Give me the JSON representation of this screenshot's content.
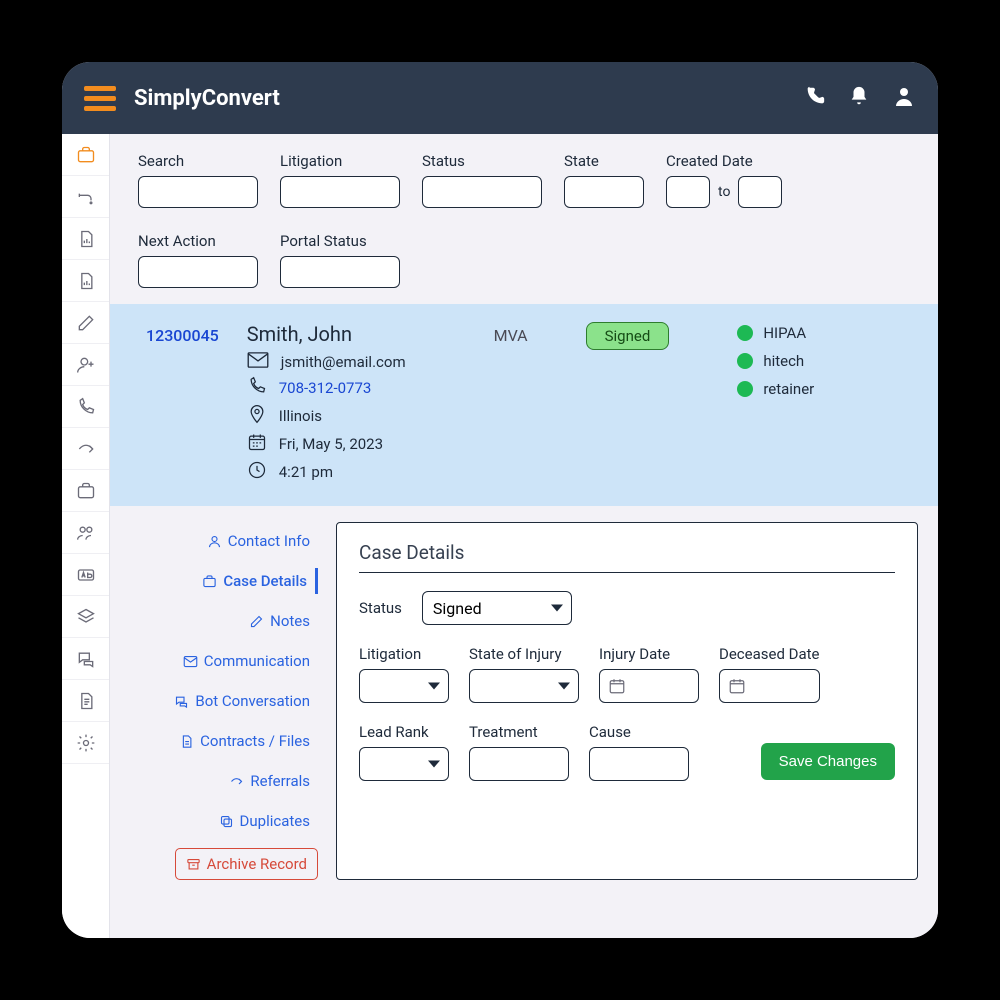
{
  "header": {
    "app_name": "SimplyConvert"
  },
  "filters": {
    "search_label": "Search",
    "litigation_label": "Litigation",
    "status_label": "Status",
    "state_label": "State",
    "created_label": "Created Date",
    "created_to": "to",
    "next_action_label": "Next Action",
    "portal_status_label": "Portal Status"
  },
  "case": {
    "id": "12300045",
    "name": "Smith, John",
    "email": "jsmith@email.com",
    "phone": "708-312-0773",
    "state": "Illinois",
    "date": "Fri, May 5, 2023",
    "time": "4:21 pm",
    "type": "MVA",
    "status_badge": "Signed",
    "tags": [
      "HIPAA",
      "hitech",
      "retainer"
    ]
  },
  "detail_nav": {
    "contact_info": "Contact Info",
    "case_details": "Case Details",
    "notes": "Notes",
    "communication": "Communication",
    "bot_conversation": "Bot Conversation",
    "contracts_files": "Contracts / Files",
    "referrals": "Referrals",
    "duplicates": "Duplicates",
    "archive": "Archive Record"
  },
  "panel": {
    "title": "Case Details",
    "status_label": "Status",
    "status_value": "Signed",
    "litigation_label": "Litigation",
    "state_injury_label": "State of Injury",
    "injury_date_label": "Injury Date",
    "deceased_date_label": "Deceased Date",
    "lead_rank_label": "Lead Rank",
    "treatment_label": "Treatment",
    "cause_label": "Cause",
    "save_label": "Save Changes"
  }
}
